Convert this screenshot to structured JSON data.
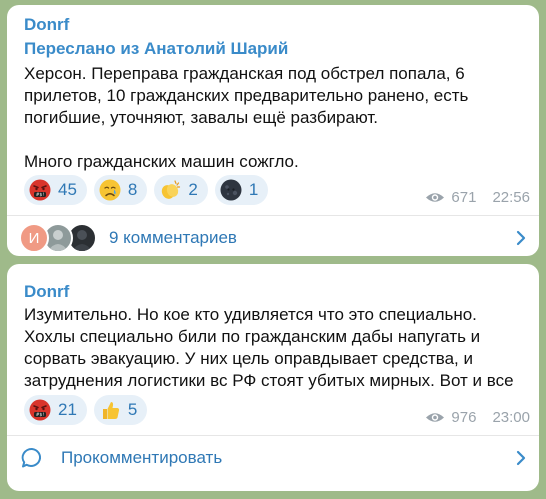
{
  "posts": [
    {
      "author": "Donrf",
      "forwarded_prefix": "Переслано из",
      "forwarded_source": "Анатолий Шарий",
      "paragraphs": [
        "Херсон. Переправа гражданская под обстрел попала,  6 прилетов, 10 гражданских предварительно ранено, есть погибшие, уточняют, завалы ещё разбирают.",
        "Много гражданских машин сожгло."
      ],
      "reactions": [
        {
          "emoji": "cursing-face",
          "count": "45"
        },
        {
          "emoji": "crying-face",
          "count": "8"
        },
        {
          "emoji": "clapping-hands",
          "count": "2"
        },
        {
          "emoji": "black-moon-face",
          "count": "1"
        }
      ],
      "views": "671",
      "time": "22:56",
      "comments": {
        "avatar_letter": "И",
        "label": "9 комментариев"
      }
    },
    {
      "author": "Donrf",
      "paragraphs": [
        "Изумительно. Но кое кто удивляется что это специально. Хохлы специально били по гражданским дабы напугать и сорвать эвакуацию. У них цель оправдывает средства, и затруднения логистики вс РФ стоят убитых мирных. Вот и все"
      ],
      "reactions": [
        {
          "emoji": "cursing-face",
          "count": "21"
        },
        {
          "emoji": "thumbs-up",
          "count": "5"
        }
      ],
      "views": "976",
      "time": "23:00",
      "comments": {
        "label": "Прокомментировать"
      }
    }
  ],
  "colors": {
    "accent": "#3a8bc9",
    "reaction_bg": "#e7f0f8",
    "background": "#9fba8a"
  }
}
